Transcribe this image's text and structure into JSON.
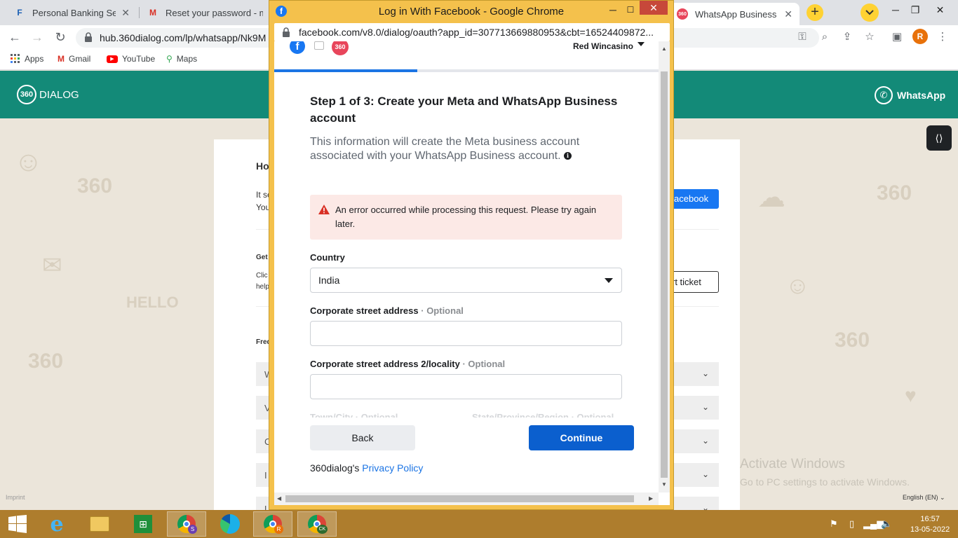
{
  "browser": {
    "tabs": [
      {
        "title": "Personal Banking Servic",
        "icon": "bank-icon"
      },
      {
        "title": "Reset your password - m",
        "icon": "gmail-icon"
      },
      {
        "title": "WhatsApp Business API",
        "icon": "dialog360-icon"
      }
    ],
    "url": "hub.360dialog.com/lp/whatsapp/Nk9M",
    "profile_initial": "R",
    "bookmarks": [
      "Apps",
      "Gmail",
      "YouTube",
      "Maps"
    ]
  },
  "page": {
    "brand": "DIALOG",
    "brand_badge": "360",
    "whatsapp": "WhatsApp",
    "card_fragments": {
      "heading": "Ho",
      "line1": "It se",
      "line2": "You",
      "get": "Get",
      "clic": "Clic",
      "help": "help",
      "freq": "Freq"
    },
    "fb_button": "acebook",
    "ticket_button": "rt ticket",
    "accordion_letters": [
      "W",
      "V",
      "C",
      "I",
      "L"
    ],
    "imprint": "Imprint",
    "language": "English (EN)",
    "activate_title": "Activate Windows",
    "activate_sub": "Go to PC settings to activate Windows."
  },
  "popup": {
    "window_title": "Log in With Facebook - Google Chrome",
    "url": "facebook.com/v8.0/dialog/oauth?app_id=307713669880953&cbt=16524409872...",
    "user_name": "Red Wincasino",
    "partner_badge": "360",
    "progress_fraction": 0.37,
    "step_title": "Step 1 of 3: Create your Meta and WhatsApp Business account",
    "step_desc": "This information will create the Meta business account associated with your WhatsApp Business account.",
    "error_message": "An error occurred while processing this request. Please try again later.",
    "country_label": "Country",
    "country_value": "India",
    "street_label": "Corporate street address",
    "street_optional": "· Optional",
    "street2_label": "Corporate street address 2/locality",
    "street2_optional": "· Optional",
    "town_label": "Town/City · Optional",
    "state_label": "State/Province/Region · Optional",
    "back_label": "Back",
    "continue_label": "Continue",
    "privacy_prefix": "360dialog's",
    "privacy_link": "Privacy Policy"
  },
  "taskbar": {
    "chrome_badges": [
      "S",
      "R",
      "CK"
    ],
    "time": "16:57",
    "date": "13-05-2022"
  },
  "colors": {
    "header_teal": "#138a78",
    "fb_blue": "#1877f2",
    "continue_blue": "#0b5fce",
    "error_bg": "#fce9e6",
    "popup_frame": "#f4c14c",
    "taskbar": "#ae7d2d"
  }
}
